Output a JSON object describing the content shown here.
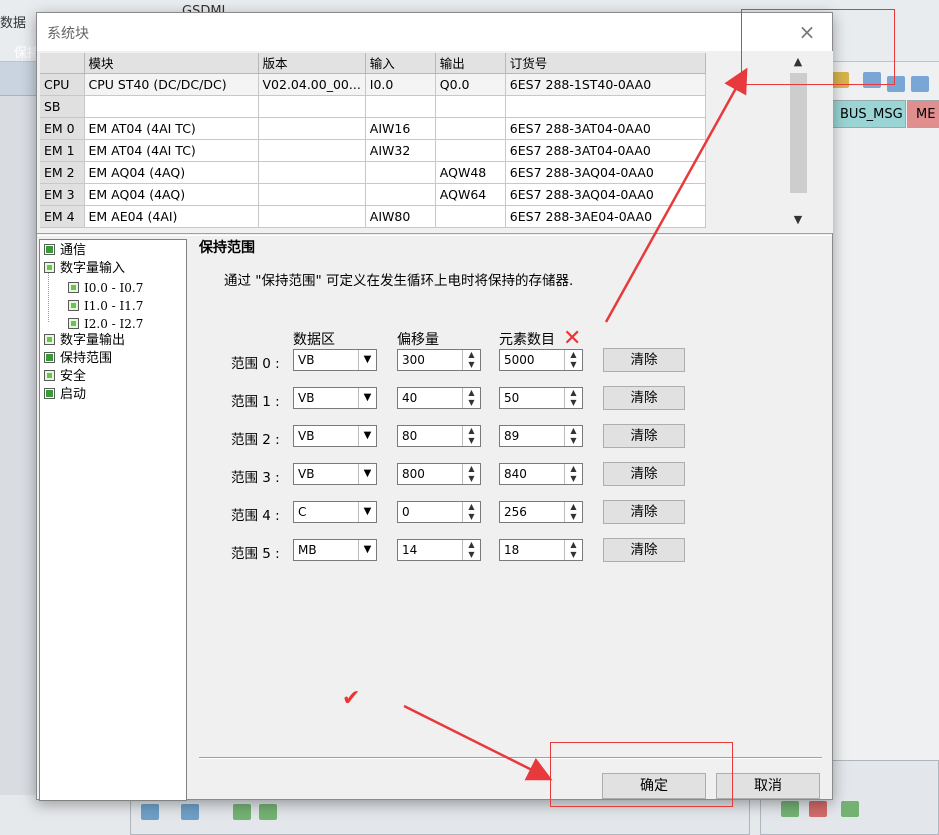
{
  "background": {
    "toolbar_text_left": "数据",
    "toolbar_text_left2": "保持",
    "toolbar_text_mid": "GSDML",
    "tab_bus": "BUS_MSG",
    "tab_me": "ME"
  },
  "dialog": {
    "title": "系统块",
    "close_glyph": "×"
  },
  "modules": {
    "headers": [
      "",
      "模块",
      "版本",
      "输入",
      "输出",
      "订货号"
    ],
    "rows": [
      [
        "CPU",
        "CPU ST40 (DC/DC/DC)",
        "V02.04.00_00...",
        "I0.0",
        "Q0.0",
        "6ES7 288-1ST40-0AA0"
      ],
      [
        "SB",
        "",
        "",
        "",
        "",
        ""
      ],
      [
        "EM 0",
        "EM AT04 (4AI TC)",
        "",
        "AIW16",
        "",
        "6ES7 288-3AT04-0AA0"
      ],
      [
        "EM 1",
        "EM AT04 (4AI TC)",
        "",
        "AIW32",
        "",
        "6ES7 288-3AT04-0AA0"
      ],
      [
        "EM 2",
        "EM AQ04 (4AQ)",
        "",
        "",
        "AQW48",
        "6ES7 288-3AQ04-0AA0"
      ],
      [
        "EM 3",
        "EM AQ04 (4AQ)",
        "",
        "",
        "AQW64",
        "6ES7 288-3AQ04-0AA0"
      ],
      [
        "EM 4",
        "EM AE04 (4AI)",
        "",
        "AIW80",
        "",
        "6ES7 288-3AE04-0AA0"
      ]
    ]
  },
  "tree": {
    "items": [
      {
        "label": "通信",
        "checked": true
      },
      {
        "label": "数字量输入",
        "checked": false
      },
      {
        "label": "I0.0 - I0.7",
        "checked": false
      },
      {
        "label": "I1.0 - I1.7",
        "checked": false
      },
      {
        "label": "I2.0 - I2.7",
        "checked": false
      },
      {
        "label": "数字量输出",
        "checked": false
      },
      {
        "label": "保持范围",
        "checked": true
      },
      {
        "label": "安全",
        "checked": false
      },
      {
        "label": "启动",
        "checked": true
      }
    ]
  },
  "retentive": {
    "section_title": "保持范围",
    "description": "通过 \"保持范围\" 可定义在发生循环上电时将保持的存储器.",
    "col_area": "数据区",
    "col_offset": "偏移量",
    "col_count": "元素数目",
    "clear_label": "清除",
    "ranges": [
      {
        "label": "范围 0 :",
        "area": "VB",
        "offset": "300",
        "count": "5000"
      },
      {
        "label": "范围 1 :",
        "area": "VB",
        "offset": "40",
        "count": "50"
      },
      {
        "label": "范围 2 :",
        "area": "VB",
        "offset": "80",
        "count": "89"
      },
      {
        "label": "范围 3 :",
        "area": "VB",
        "offset": "800",
        "count": "840"
      },
      {
        "label": "范围 4 :",
        "area": "C",
        "offset": "0",
        "count": "256"
      },
      {
        "label": "范围 5 :",
        "area": "MB",
        "offset": "14",
        "count": "18"
      }
    ]
  },
  "buttons": {
    "ok": "确定",
    "cancel": "取消"
  },
  "annotations": {
    "cross_mark": "✕",
    "check_mark": "✔",
    "color": "#e8393c"
  }
}
